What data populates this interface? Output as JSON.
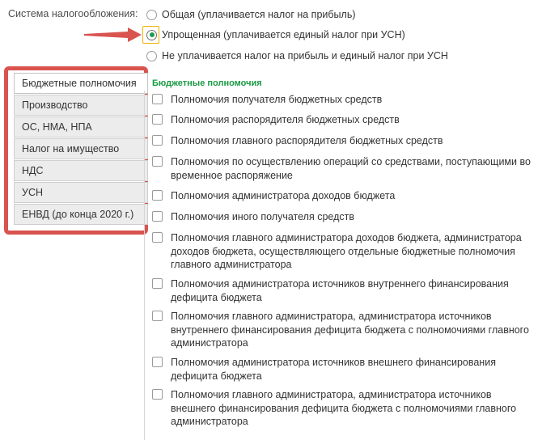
{
  "tax_system": {
    "label": "Система налогообложения:",
    "options": [
      "Общая (уплачивается налог на прибыль)",
      "Упрощенная (уплачивается единый налог при УСН)",
      "Не уплачивается налог на прибыль и единый налог при УСН"
    ],
    "selected_index": 1
  },
  "tabs": [
    "Бюджетные полномочия",
    "Производство",
    "ОС, НМА, НПА",
    "Налог на имущество",
    "НДС",
    "УСН",
    "ЕНВД (до конца 2020 г.)"
  ],
  "active_tab_index": 0,
  "section": {
    "title": "Бюджетные полномочия",
    "items": [
      "Полномочия получателя бюджетных средств",
      "Полномочия распорядителя бюджетных средств",
      "Полномочия главного распорядителя бюджетных средств",
      "Полномочия по осуществлению операций со средствами, поступающими во временное распоряжение",
      "Полномочия администратора доходов бюджета",
      "Полномочия иного получателя средств",
      "Полномочия главного администратора доходов бюджета, администратора доходов бюджета, осуществляющего отдельные бюджетные полномочия главного администратора",
      "Полномочия администратора источников внутреннего финансирования дефицита бюджета",
      "Полномочия главного администратора, администратора источников внутреннего финансирования дефицита бюджета с полномочиями главного администратора",
      "Полномочия администратора источников внешнего финансирования дефицита бюджета",
      "Полномочия главного администратора, администратора источников внешнего финансирования дефицита бюджета с полномочиями главного администратора"
    ]
  },
  "colors": {
    "accent_green": "#1a9a43",
    "highlight_red": "#d9534f",
    "focus_yellow": "#f0b000"
  }
}
